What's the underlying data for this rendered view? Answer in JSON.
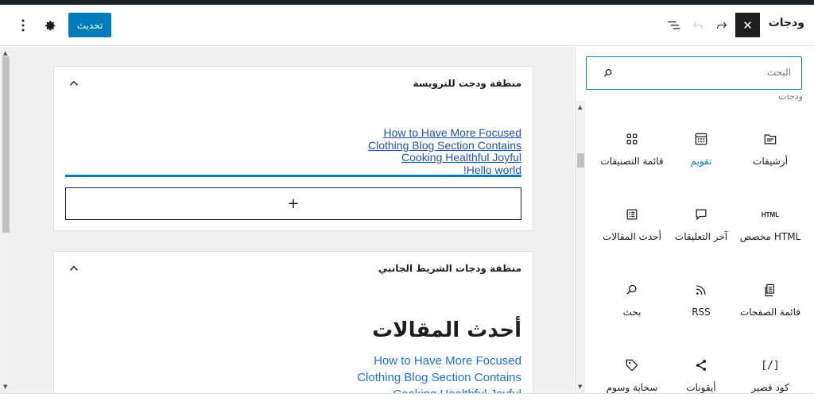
{
  "header": {
    "title": "ودجات",
    "close_label": "✕",
    "update_label": "تحديث"
  },
  "inserter": {
    "search_placeholder": "البحث",
    "cut_label": "ودجات",
    "blocks": [
      {
        "label": "أرشيفات",
        "icon": "archive-icon"
      },
      {
        "label": "تقويم",
        "icon": "calendar-icon",
        "active": true
      },
      {
        "label": "قائمة التصنيفات",
        "icon": "categories-icon"
      },
      {
        "label": "HTML مخصص",
        "icon": "html-icon"
      },
      {
        "label": "آخر التعليقات",
        "icon": "comment-icon"
      },
      {
        "label": "أحدث المقالات",
        "icon": "latest-posts-icon"
      },
      {
        "label": "قائمة الصفحات",
        "icon": "pages-list-icon"
      },
      {
        "label": "RSS",
        "icon": "rss-icon"
      },
      {
        "label": "بحث",
        "icon": "search-icon"
      },
      {
        "label": "كود قصير",
        "icon": "shortcode-icon"
      },
      {
        "label": "أيقونات",
        "icon": "share-icon"
      },
      {
        "label": "سحابة وسوم",
        "icon": "tag-icon"
      }
    ],
    "html_icon_text": "HTML",
    "shortcode_icon_text": "[/]"
  },
  "areas": {
    "header_area": {
      "title": "منطقة ودجت للترويسة",
      "links": [
        "How to Have More Focused",
        "Clothing Blog Section Contains",
        "Cooking Healthful Joyful",
        "!Hello world"
      ],
      "add_label": "+"
    },
    "sidebar_area": {
      "title": "منطقة ودجات الشريط الجانبي",
      "heading": "أحدث المقالات",
      "links": [
        "How to Have More Focused",
        "Clothing Blog Section Contains",
        "Cooking Healthful Joyful"
      ]
    }
  },
  "footer": {
    "label": "ودجات"
  },
  "colors": {
    "accent": "#007cba",
    "link": "#1f56b6",
    "dark": "#1e1e1e",
    "canvas_bg": "#f0f0f0"
  }
}
